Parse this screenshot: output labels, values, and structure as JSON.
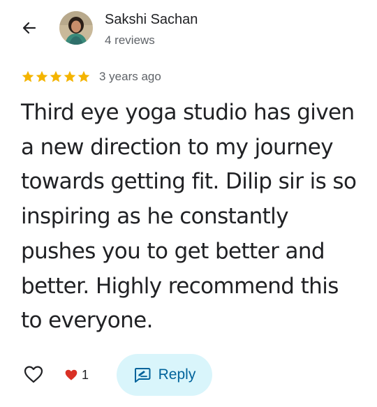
{
  "author": {
    "name": "Sakshi Sachan",
    "review_count": "4 reviews",
    "avatar_icon": "profile-photo"
  },
  "review": {
    "rating": 5,
    "rating_max": 5,
    "date": "3 years ago",
    "text": "Third eye yoga studio has given a new direction to my journey towards getting fit. Dilip sir is so inspiring as he constantly pushes you to get better and better. Highly recommend this to everyone."
  },
  "actions": {
    "like_icon": "heart-outline-icon",
    "reaction_icon": "red-heart-icon",
    "reaction_count": "1",
    "reply_label": "Reply",
    "reply_icon": "reply-icon"
  },
  "colors": {
    "star": "#f4b400",
    "reply_bg": "#d9f5fb",
    "reply_text": "#00639b",
    "heart_red": "#d93025",
    "text_primary": "#202124",
    "text_secondary": "#5f6368"
  }
}
